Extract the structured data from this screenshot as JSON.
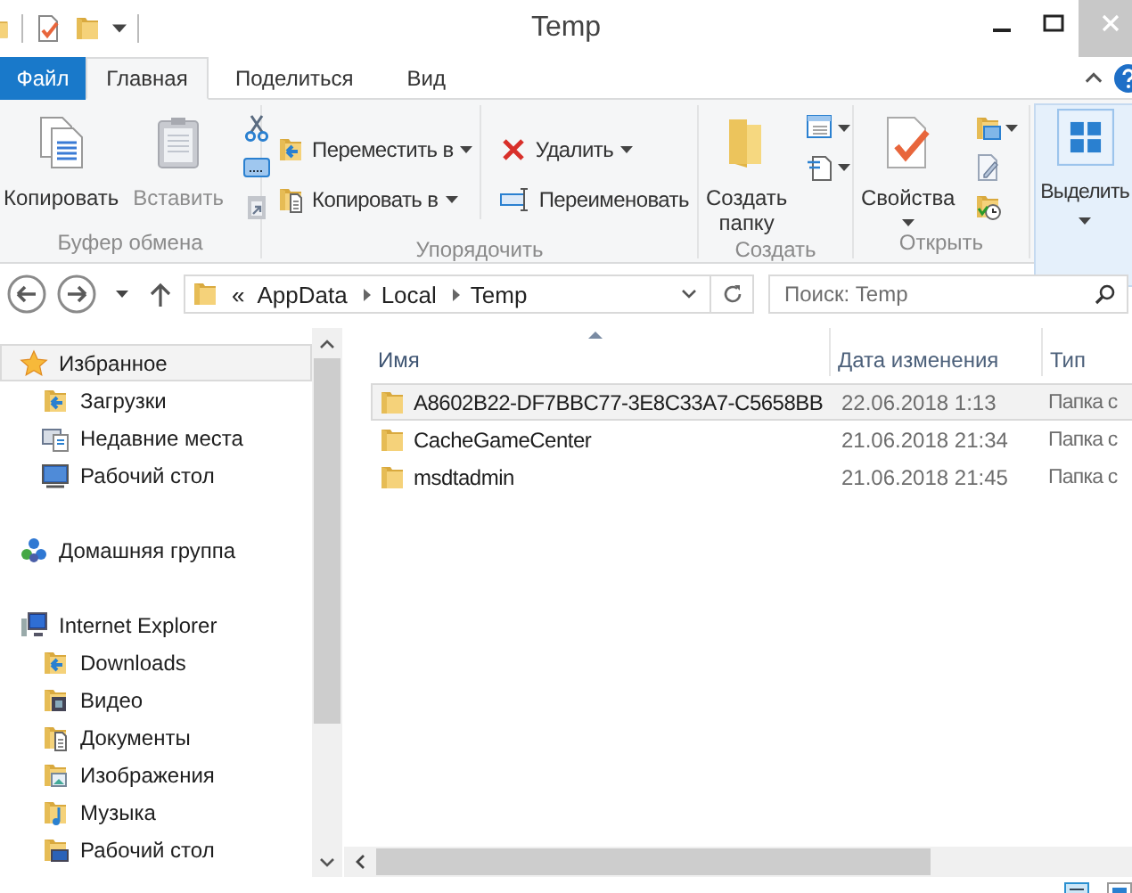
{
  "window": {
    "title": "Temp"
  },
  "tabs": [
    {
      "label": "Файл",
      "kind": "file",
      "selected": false
    },
    {
      "label": "Главная",
      "kind": "tab",
      "selected": true
    },
    {
      "label": "Поделиться",
      "kind": "tab",
      "selected": false
    },
    {
      "label": "Вид",
      "kind": "tab",
      "selected": false
    }
  ],
  "ribbon": [
    {
      "label": "Буфер обмена",
      "items": [
        {
          "kind": "large",
          "label": "Копировать",
          "disabled": false,
          "dropdown": false
        },
        {
          "kind": "large",
          "label": "Вставить",
          "disabled": true,
          "dropdown": false
        },
        {
          "kind": "icon-stack"
        }
      ]
    },
    {
      "label": "Упорядочить",
      "items": [
        {
          "kind": "rows",
          "rows": [
            {
              "label": "Переместить в",
              "dropdown": true
            },
            {
              "label": "Копировать в",
              "dropdown": true
            }
          ]
        },
        {
          "kind": "rows",
          "rows": [
            {
              "label": "Удалить",
              "dropdown": true
            },
            {
              "label": "Переименовать",
              "dropdown": false
            }
          ]
        }
      ]
    },
    {
      "label": "Создать",
      "items": [
        {
          "kind": "large",
          "label": "Создать папку",
          "disabled": false,
          "dropdown": false
        },
        {
          "kind": "icon-stack"
        }
      ]
    },
    {
      "label": "Открыть",
      "items": [
        {
          "kind": "large",
          "label": "Свойства",
          "disabled": false,
          "dropdown": true
        },
        {
          "kind": "icon-stack"
        }
      ]
    },
    {
      "items": [
        {
          "kind": "large",
          "label": "Выделить",
          "disabled": false,
          "dropdown": true,
          "hovered": true
        }
      ]
    }
  ],
  "address": {
    "overflow": "«",
    "crumbs": [
      "AppData",
      "Local",
      "Temp"
    ]
  },
  "search": {
    "placeholder": "Поиск: Temp"
  },
  "navigation": [
    {
      "label": "Избранное",
      "selected": true,
      "children": [
        {
          "label": "Загрузки",
          "selected": false
        },
        {
          "label": "Недавние места",
          "selected": false
        },
        {
          "label": "Рабочий стол",
          "selected": false
        }
      ]
    },
    {
      "label": "Домашняя группа",
      "selected": false
    },
    {
      "label": "Internet Explorer",
      "selected": false,
      "children": [
        {
          "label": "Downloads",
          "selected": false
        },
        {
          "label": "Видео",
          "selected": false
        },
        {
          "label": "Документы",
          "selected": false
        },
        {
          "label": "Изображения",
          "selected": false
        },
        {
          "label": "Музыка",
          "selected": false
        },
        {
          "label": "Рабочий стол",
          "selected": false
        }
      ]
    }
  ],
  "columns": [
    {
      "label": "Имя",
      "sorted": true
    },
    {
      "label": "Дата изменения",
      "sorted": false
    },
    {
      "label": "Тип",
      "sorted": false
    }
  ],
  "rows": [
    {
      "name": "A8602B22-DF7BBC77-3E8C33A7-C5658BB",
      "date": "22.06.2018 1:13",
      "type": "Папка с",
      "selected": true
    },
    {
      "name": "CacheGameCenter",
      "date": "21.06.2018 21:34",
      "type": "Папка с",
      "selected": false
    },
    {
      "name": "msdtadmin",
      "date": "21.06.2018 21:45",
      "type": "Папка с",
      "selected": false
    }
  ]
}
